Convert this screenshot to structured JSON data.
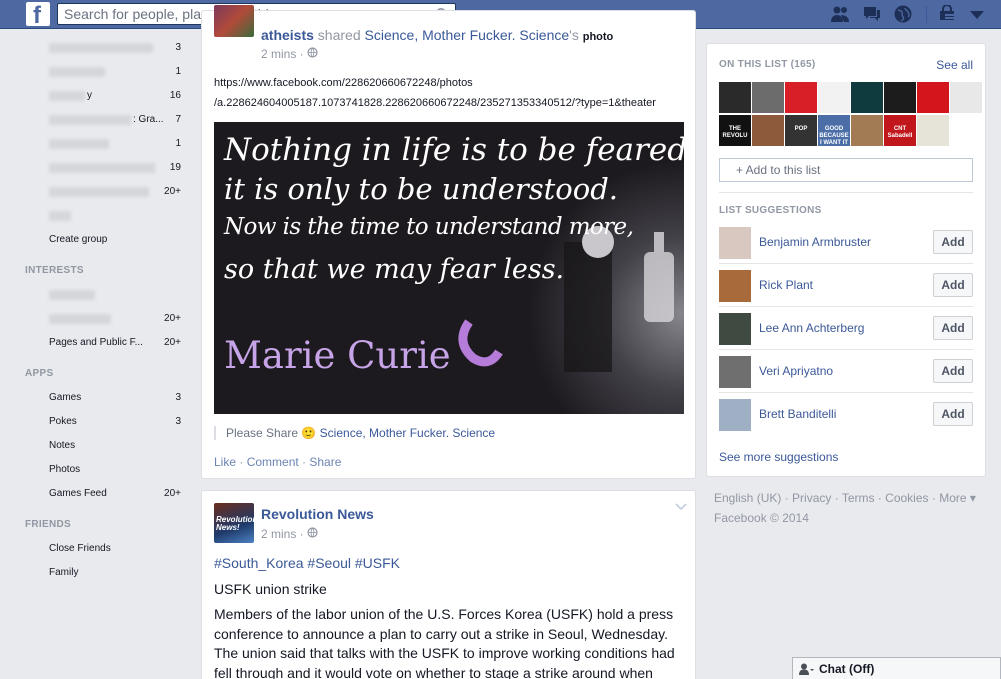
{
  "topbar": {
    "logo": "f",
    "search_placeholder": "Search for people, places and things",
    "icons": [
      "friend-requests-icon",
      "messages-icon",
      "notifications-icon",
      "privacy-shortcuts-icon",
      "account-menu-icon"
    ]
  },
  "sidebar": {
    "top_counts": [
      "3",
      "1",
      "16",
      "7",
      "1",
      "19",
      "20+"
    ],
    "partial_labels": {
      "row3_suffix": "y",
      "row4_suffix": ": Gra..."
    },
    "create_group": "Create group",
    "interests_heading": "INTERESTS",
    "interests": [
      {
        "label": "",
        "count": ""
      },
      {
        "label": "",
        "count": "20+"
      },
      {
        "label": "Pages and Public F...",
        "count": "20+"
      }
    ],
    "apps_heading": "APPS",
    "apps": [
      {
        "label": "Games",
        "count": "3"
      },
      {
        "label": "Pokes",
        "count": "3"
      },
      {
        "label": "Notes",
        "count": ""
      },
      {
        "label": "Photos",
        "count": ""
      },
      {
        "label": "Games Feed",
        "count": "20+"
      }
    ],
    "friends_heading": "FRIENDS",
    "friends": [
      {
        "label": "Close Friends"
      },
      {
        "label": "Family"
      }
    ]
  },
  "post1": {
    "author": "atheists",
    "action": " shared ",
    "page": "Science, Mother Fucker. Science",
    "possessive": "'s ",
    "object": "photo",
    "time": "2 mins ·",
    "url_line1": "https://www.facebook.com/228620660672248/photos",
    "url_line2": "/a.228624604005187.1073741828.228620660672248/235271353340512/?type=1&theater",
    "quote_lines": [
      "Nothing in life is to be feared,",
      "it is only to be understood.",
      "Now is the time to understand more,",
      "so that we may fear less."
    ],
    "quote_author": "Marie Curie",
    "caption_prefix": "Please Share ",
    "caption_emoji": "🙂",
    "caption_link": " Science, Mother Fucker. Science",
    "actions": {
      "like": "Like",
      "comment": "Comment",
      "share": "Share",
      "sep": " · "
    }
  },
  "post2": {
    "author": "Revolution News",
    "avatar_text": "Revolution News!",
    "time": "2 mins ·",
    "hashtags": "#South_Korea #Seoul #USFK",
    "title": "USFK union strike",
    "body": "Members of the labor union of the U.S. Forces Korea (USFK) hold a press conference to announce a plan to carry out a strike in Seoul, Wednesday. The union said that talks with the USFK to improve working conditions had fell through and it would vote on whether to stage a strike around when"
  },
  "right": {
    "on_list": "ON THIS LIST (165)",
    "see_all": "See all",
    "thumb_texts": [
      "",
      "",
      "",
      "",
      "",
      "",
      "",
      "",
      "THE REVOLU",
      "",
      "POP",
      "GOOD BECAUSE I WANT IT",
      "",
      "CNT Sabadell",
      ""
    ],
    "thumb_colors": [
      "#2a2a2a",
      "#6c6c6c",
      "#d81e27",
      "#f2f2f2",
      "#0f3b3f",
      "#1c1c1c",
      "#d3151c",
      "#e8e8e8",
      "#111111",
      "#8e5a3c",
      "#333333",
      "#4b6ea8",
      "#a27a54",
      "#c0161c",
      "#e6e4d8"
    ],
    "add_to_list": "+ Add to this list",
    "suggestions_heading": "LIST SUGGESTIONS",
    "suggestions": [
      {
        "name": "Benjamin Armbruster",
        "button": "Add",
        "color": "#d9c8c0"
      },
      {
        "name": "Rick Plant",
        "button": "Add",
        "color": "#a86a3a"
      },
      {
        "name": "Lee Ann Achterberg",
        "button": "Add",
        "color": "#3f4a40"
      },
      {
        "name": "Veri Apriyatno",
        "button": "Add",
        "color": "#6f6f6f"
      },
      {
        "name": "Brett Banditelli",
        "button": "Add",
        "color": "#9fb0c4"
      }
    ],
    "see_more": "See more suggestions"
  },
  "footer": {
    "links": [
      "English (UK)",
      "Privacy",
      "Terms",
      "Cookies",
      "More ▾"
    ],
    "sep": " · ",
    "copyright": "Facebook © 2014"
  },
  "chat": {
    "label": "Chat (Off)"
  },
  "colors": {
    "brand": "#4e69a2",
    "link": "#3b5998",
    "muted": "#9197a3"
  }
}
